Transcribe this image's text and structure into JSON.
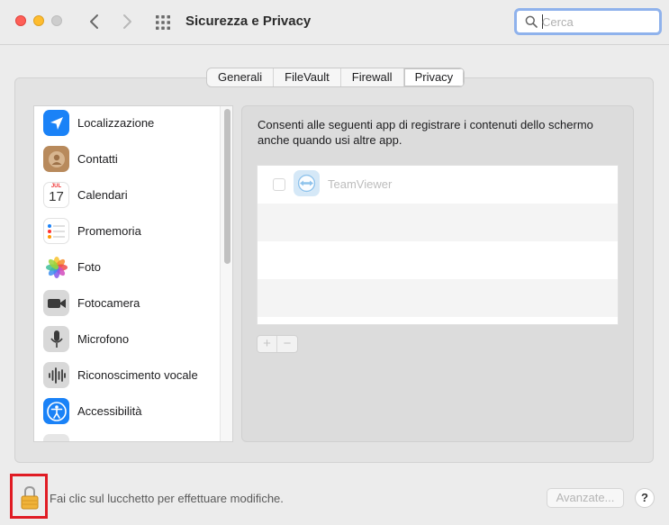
{
  "window": {
    "title": "Sicurezza e Privacy"
  },
  "search": {
    "placeholder": "Cerca",
    "value": ""
  },
  "tabs": [
    {
      "label": "Generali",
      "active": false
    },
    {
      "label": "FileVault",
      "active": false
    },
    {
      "label": "Firewall",
      "active": false
    },
    {
      "label": "Privacy",
      "active": true
    }
  ],
  "sidebar": {
    "items": [
      {
        "label": "Localizzazione",
        "icon": "location-arrow-icon"
      },
      {
        "label": "Contatti",
        "icon": "contacts-icon"
      },
      {
        "label": "Calendari",
        "icon": "calendar-icon",
        "calendar_month": "JUL",
        "calendar_day": "17"
      },
      {
        "label": "Promemoria",
        "icon": "reminders-icon"
      },
      {
        "label": "Foto",
        "icon": "photos-icon"
      },
      {
        "label": "Fotocamera",
        "icon": "camera-icon"
      },
      {
        "label": "Microfono",
        "icon": "microphone-icon"
      },
      {
        "label": "Riconoscimento vocale",
        "icon": "speech-recognition-icon"
      },
      {
        "label": "Accessibilità",
        "icon": "accessibility-icon"
      }
    ]
  },
  "main": {
    "description": "Consenti alle seguenti app di registrare i contenuti dello schermo anche quando usi altre app.",
    "apps": [
      {
        "name": "TeamViewer",
        "checked": false,
        "icon": "teamviewer-icon"
      }
    ],
    "add_label": "+",
    "remove_label": "−"
  },
  "footer": {
    "lock_text": "Fai clic sul lucchetto per effettuare modifiche.",
    "advanced_label": "Avanzate...",
    "help_label": "?"
  },
  "colors": {
    "lock_highlight": "#e01c24",
    "close": "#fe5f57",
    "minimize": "#febc2e"
  }
}
